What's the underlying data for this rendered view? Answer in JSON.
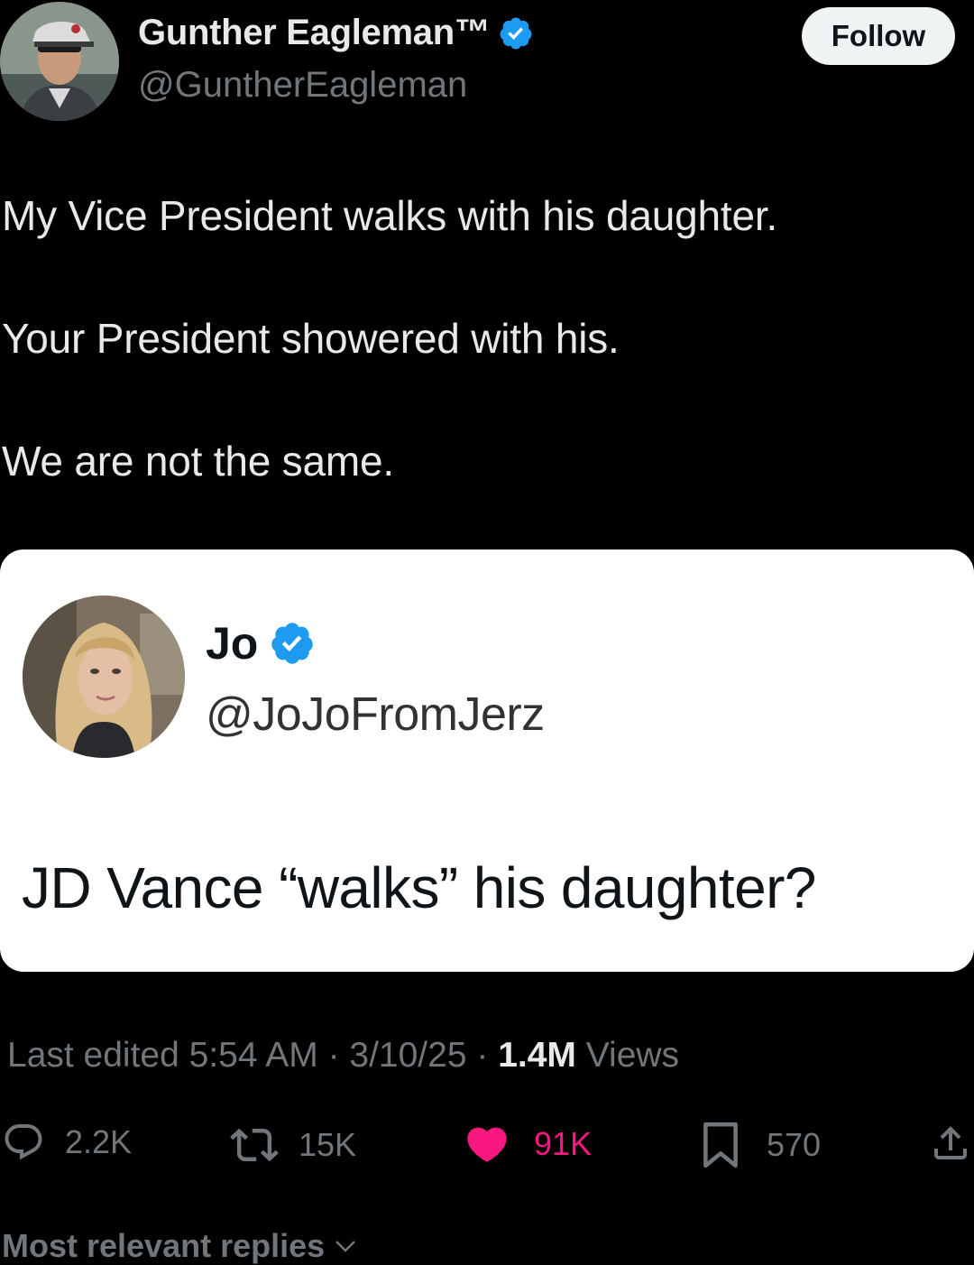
{
  "author": {
    "name": "Gunther Eagleman",
    "trademark": "™",
    "handle": "@GuntherEagleman",
    "verified": true
  },
  "follow_label": "Follow",
  "tweet": {
    "lines": [
      "My Vice President walks with his daughter.",
      "Your President showered with his.",
      "We are not the same."
    ]
  },
  "quote": {
    "name": "Jo",
    "handle": "@JoJoFromJerz",
    "verified": true,
    "text": "JD Vance “walks” his daughter?"
  },
  "meta": {
    "edited": "Last edited 5:54 AM · 3/10/25",
    "separator": " · ",
    "views_count": "1.4M",
    "views_label": " Views"
  },
  "actions": {
    "replies": "2.2K",
    "reposts": "15K",
    "likes": "91K",
    "bookmarks": "570"
  },
  "replies_sort": "Most relevant replies",
  "colors": {
    "background": "#000000",
    "like": "#f91880",
    "verified": "#1d9bf0",
    "muted": "#71767b"
  }
}
